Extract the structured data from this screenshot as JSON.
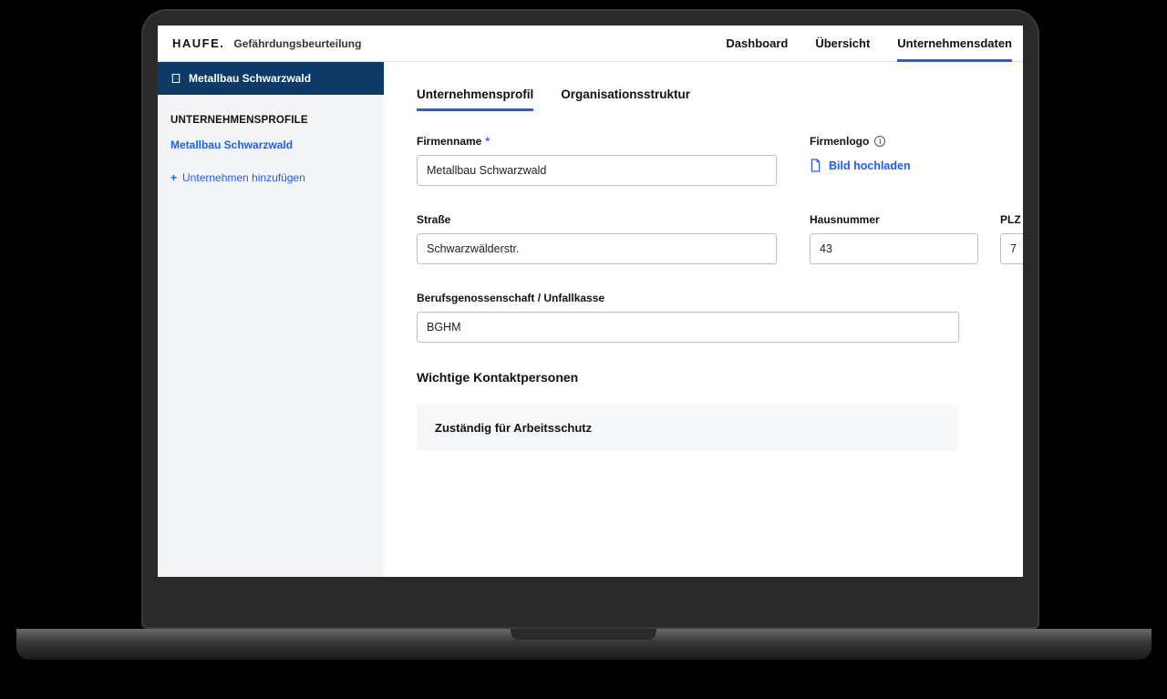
{
  "header": {
    "logo": "HAUFE",
    "appTitle": "Gefährdungsbeurteilung",
    "nav": {
      "dashboard": "Dashboard",
      "overview": "Übersicht",
      "companyData": "Unternehmensdaten"
    }
  },
  "sidebar": {
    "currentCompany": "Metallbau Schwarzwald",
    "sectionTitle": "UNTERNEHMENSPROFILE",
    "selectedCompany": "Metallbau Schwarzwald",
    "addCompany": "Unternehmen hinzufügen"
  },
  "tabs": {
    "profile": "Unternehmensprofil",
    "orgStructure": "Organisationsstruktur"
  },
  "form": {
    "companyNameLabel": "Firmenname",
    "companyNameValue": "Metallbau Schwarzwald",
    "logoLabel": "Firmenlogo",
    "uploadLabel": "Bild hochladen",
    "streetLabel": "Straße",
    "streetValue": "Schwarzwälderstr.",
    "houseNoLabel": "Hausnummer",
    "houseNoValue": "43",
    "plzLabel": "PLZ",
    "plzValue": "7",
    "bgLabel": "Berufsgenossenschaft / Unfallkasse",
    "bgValue": "BGHM",
    "contactsHeading": "Wichtige Kontaktpersonen",
    "safetyResponsible": "Zuständig für Arbeitsschutz"
  }
}
